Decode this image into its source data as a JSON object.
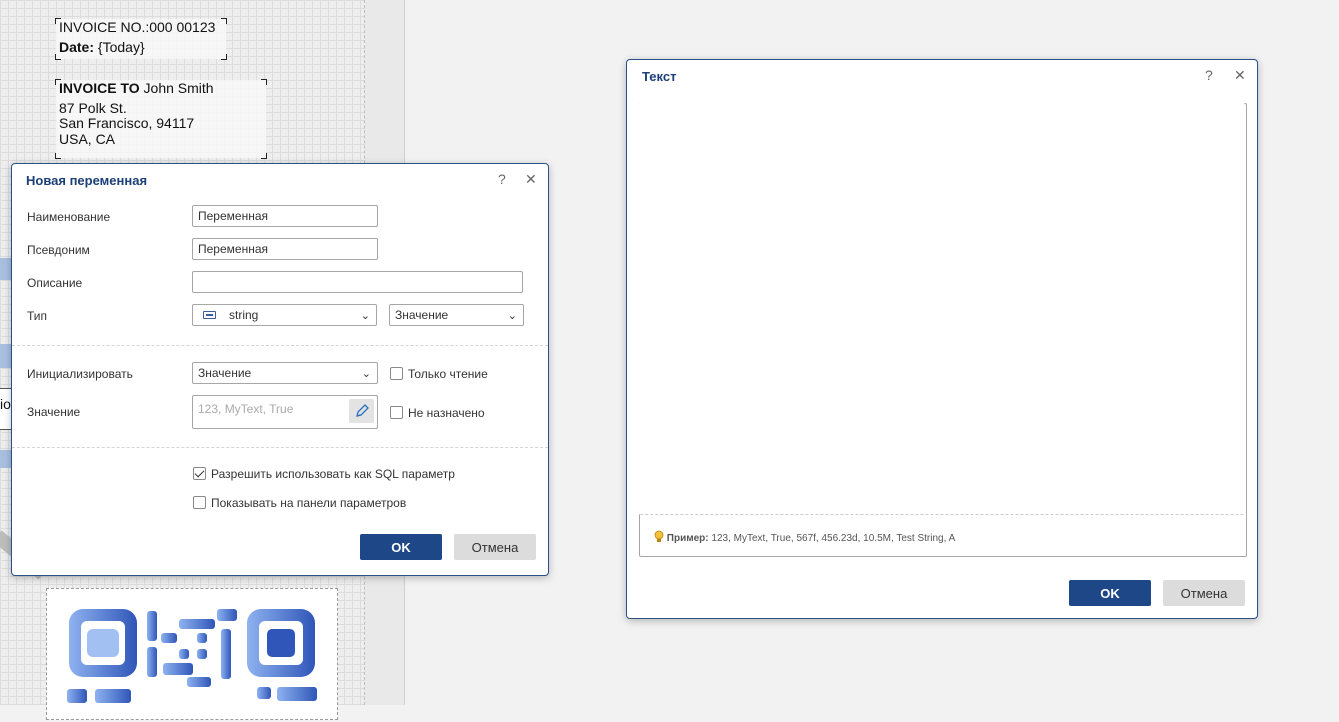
{
  "report": {
    "invoice_no": "INVOICE NO.:000 00123",
    "date_label": "Date:",
    "date_value": "{Today}",
    "invoice_to_label": "INVOICE TO",
    "invoice_to_name": "John Smith",
    "address_lines": [
      "87 Polk St.",
      "San Francisco, 94117",
      "USA, CA"
    ],
    "partial_text": "io"
  },
  "variable_dialog": {
    "title": "Новая переменная",
    "help": "?",
    "close": "✕",
    "name_label": "Наименование",
    "name_value": "Переменная",
    "alias_label": "Псевдоним",
    "alias_value": "Переменная",
    "description_label": "Описание",
    "description_value": "",
    "type_label": "Тип",
    "type_value": "string",
    "type_mode_value": "Значение",
    "init_label": "Инициализировать",
    "init_value": "Значение",
    "readonly_label": "Только чтение",
    "value_label": "Значение",
    "value_placeholder": "123, MyText, True",
    "unassigned_label": "Не назначено",
    "sql_param_label": "Разрешить использовать как SQL параметр",
    "sql_param_checked": true,
    "show_panel_label": "Показывать на панели параметров",
    "show_panel_checked": false,
    "ok_label": "OK",
    "cancel_label": "Отмена"
  },
  "text_dialog": {
    "title": "Текст",
    "help": "?",
    "close": "✕",
    "text_value": "",
    "hint_label": "Пример:",
    "hint_examples": "123,  MyText,  True,  567f,  456.23d,  10.5M,  Test String,  A",
    "ok_label": "OK",
    "cancel_label": "Отмена"
  },
  "colors": {
    "accent": "#1e4788",
    "title": "#1c3f77",
    "qr_light": "#8fb2f0",
    "qr_dark": "#2f56b8"
  }
}
